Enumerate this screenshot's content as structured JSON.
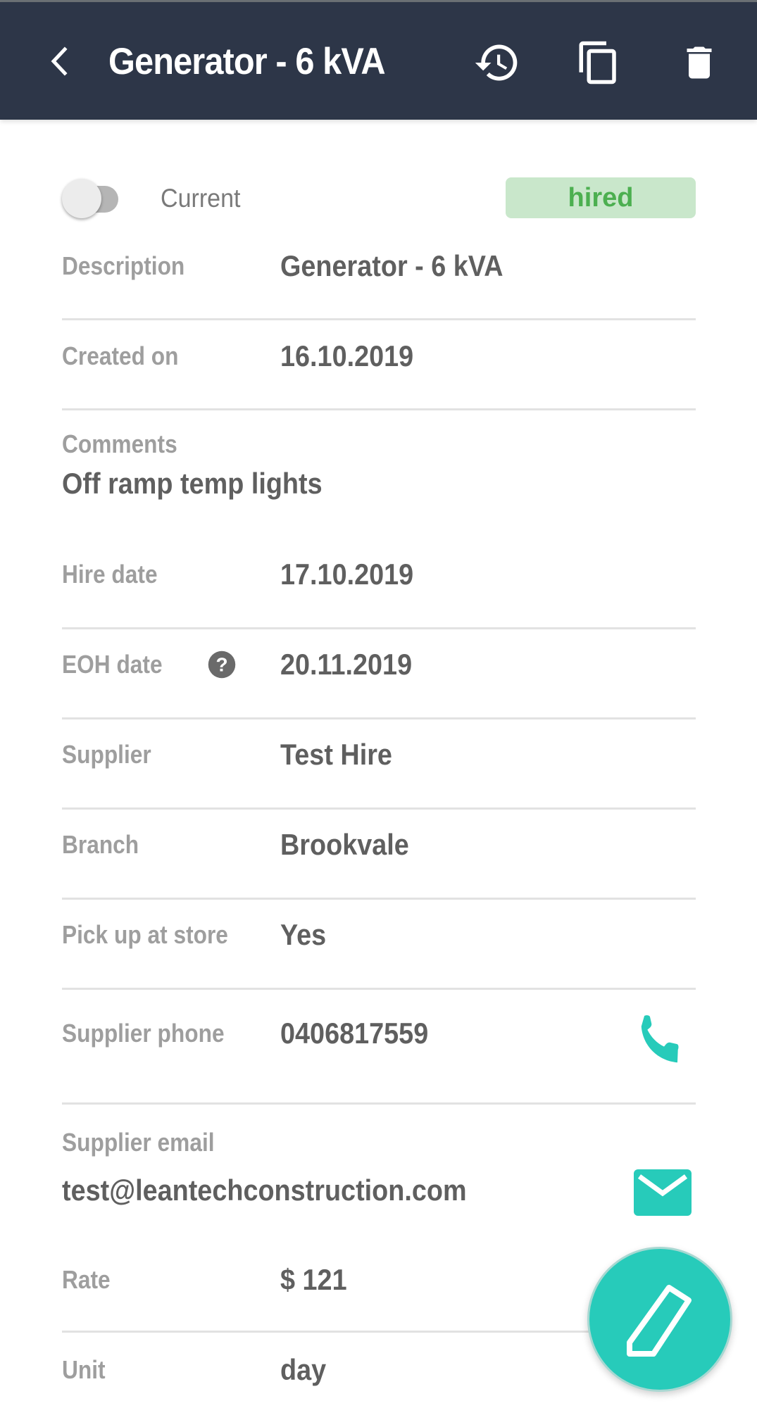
{
  "appbar": {
    "title": "Generator - 6 kVA",
    "icons": {
      "back": "chevron-left-icon",
      "history": "history-icon",
      "copy": "copy-icon",
      "delete": "trash-icon"
    }
  },
  "current_toggle": {
    "label": "Current",
    "on": false
  },
  "status_badge": {
    "text": "hired",
    "text_color": "#4caf50",
    "bg_color": "#c9e7cb"
  },
  "fields": {
    "description": {
      "label": "Description",
      "value": "Generator - 6 kVA"
    },
    "created_on": {
      "label": "Created on",
      "value": "16.10.2019"
    },
    "comments": {
      "label": "Comments",
      "value": "Off ramp temp lights"
    },
    "hire_date": {
      "label": "Hire date",
      "value": "17.10.2019"
    },
    "eoh_date": {
      "label": "EOH date",
      "value": "20.11.2019",
      "help_icon": "help-circle-icon"
    },
    "supplier": {
      "label": "Supplier",
      "value": "Test Hire"
    },
    "branch": {
      "label": "Branch",
      "value": "Brookvale"
    },
    "pick_up_at_store": {
      "label": "Pick up at store",
      "value": "Yes"
    },
    "supplier_phone": {
      "label": "Supplier phone",
      "value": "0406817559",
      "action_icon": "phone-icon"
    },
    "supplier_email": {
      "label": "Supplier email",
      "value": "test@leantechconstruction.com",
      "action_icon": "mail-icon"
    },
    "rate": {
      "label": "Rate",
      "value": "$ 121"
    },
    "unit": {
      "label": "Unit",
      "value": "day"
    }
  },
  "fab": {
    "icon": "pencil-icon",
    "action": "edit"
  },
  "colors": {
    "appbar": "#2d3648",
    "accent": "#27cbba",
    "label": "#9e9e9e",
    "value": "#5f5f5f",
    "divider": "#e2e2e2"
  }
}
